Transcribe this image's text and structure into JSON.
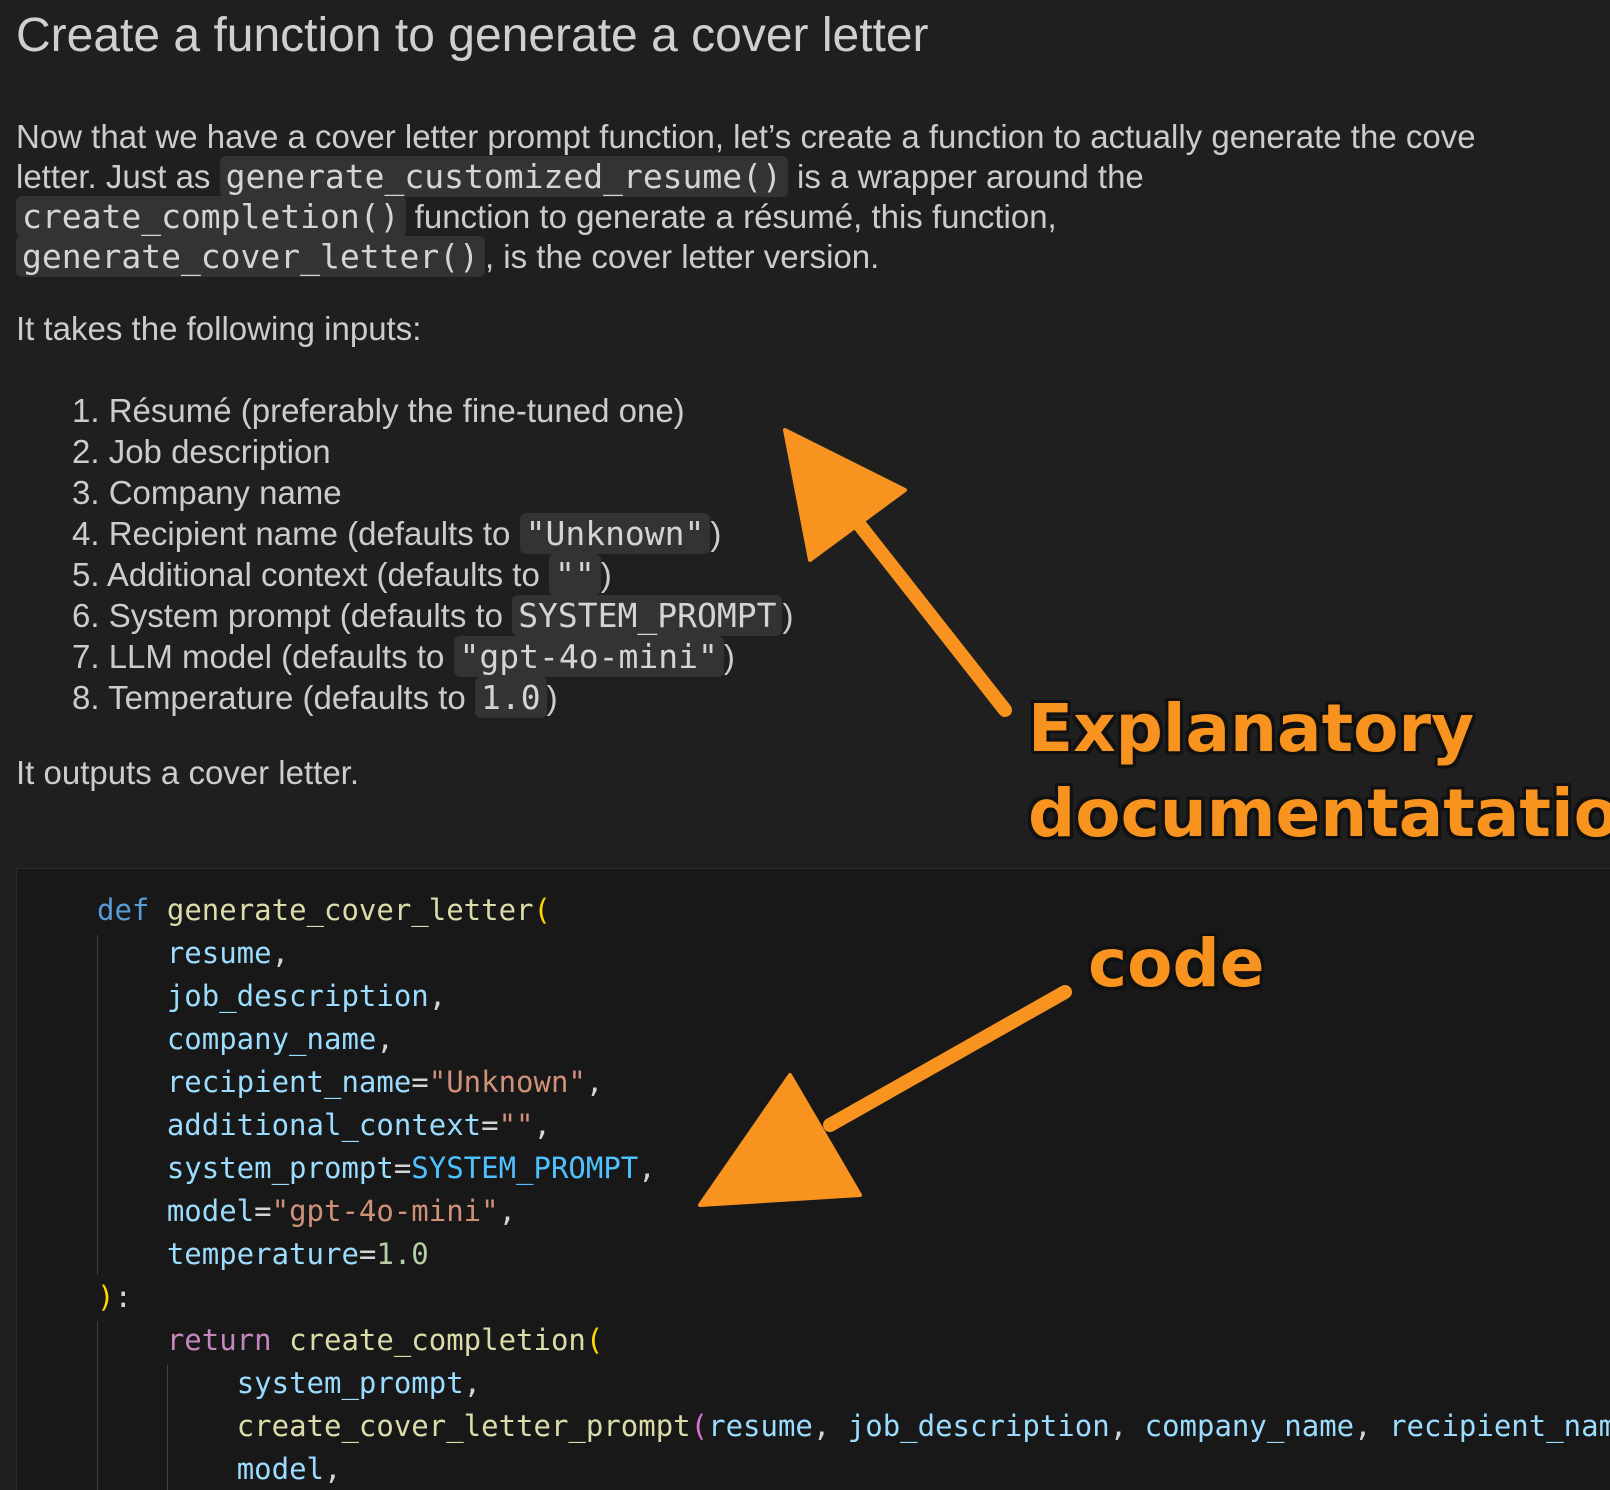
{
  "header": {
    "title": "Create a function to generate a cover letter"
  },
  "intro": {
    "p1_a": "Now that we have a cover letter prompt function, let’s create a function to actually generate the cove",
    "p1_b": "letter. Just as ",
    "code1": "generate_customized_resume()",
    "p1_c": " is a wrapper around the",
    "code2": "create_completion()",
    "p1_d": " function to generate a résumé, this function,",
    "code3": "generate_cover_letter()",
    "p1_e": ", is the cover letter version."
  },
  "inputs_heading": "It takes the following inputs:",
  "inputs": [
    {
      "text": "1. Résumé (preferably the fine-tuned one)",
      "code": "",
      "after": ""
    },
    {
      "text": "2. Job description",
      "code": "",
      "after": ""
    },
    {
      "text": "3. Company name",
      "code": "",
      "after": ""
    },
    {
      "text": "4. Recipient name (defaults to ",
      "code": "\"Unknown\"",
      "after": ")"
    },
    {
      "text": "5. Additional context (defaults to ",
      "code": "\"\"",
      "after": ")"
    },
    {
      "text": "6. System prompt (defaults to ",
      "code": "SYSTEM_PROMPT",
      "after": ")"
    },
    {
      "text": "7. LLM model (defaults to ",
      "code": "\"gpt-4o-mini\"",
      "after": ")"
    },
    {
      "text": "8. Temperature (defaults to ",
      "code": "1.0",
      "after": ")"
    }
  ],
  "outputs": "It outputs a cover letter.",
  "annotations": {
    "docs_line1": "Explanatory",
    "docs_line2": "documentatation",
    "code": "code"
  },
  "code": {
    "def": "def",
    "fn_name": "generate_cover_letter",
    "open_paren": "(",
    "params": [
      {
        "name": "resume",
        "eq": "",
        "value": "",
        "value_kind": "",
        "sep": ","
      },
      {
        "name": "job_description",
        "eq": "",
        "value": "",
        "value_kind": "",
        "sep": ","
      },
      {
        "name": "company_name",
        "eq": "",
        "value": "",
        "value_kind": "",
        "sep": ","
      },
      {
        "name": "recipient_name",
        "eq": "=",
        "value": "\"Unknown\"",
        "value_kind": "s",
        "sep": ","
      },
      {
        "name": "additional_context",
        "eq": "=",
        "value": "\"\"",
        "value_kind": "s",
        "sep": ","
      },
      {
        "name": "system_prompt",
        "eq": "=",
        "value": "SYSTEM_PROMPT",
        "value_kind": "c",
        "sep": ","
      },
      {
        "name": "model",
        "eq": "=",
        "value": "\"gpt-4o-mini\"",
        "value_kind": "s",
        "sep": ","
      },
      {
        "name": "temperature",
        "eq": "=",
        "value": "1.0",
        "value_kind": "n",
        "sep": ""
      }
    ],
    "close": "):",
    "return_kw": "return",
    "call_fn": "create_completion",
    "call_args": {
      "a1": "system_prompt",
      "inner_fn": "create_cover_letter_prompt",
      "inner_args": [
        "resume",
        "job_description",
        "company_name",
        "recipient_nam"
      ],
      "a3": "model"
    }
  },
  "colors": {
    "accent_orange": "#f7931e",
    "background": "#1f1f1f",
    "code_bg": "#181818"
  }
}
